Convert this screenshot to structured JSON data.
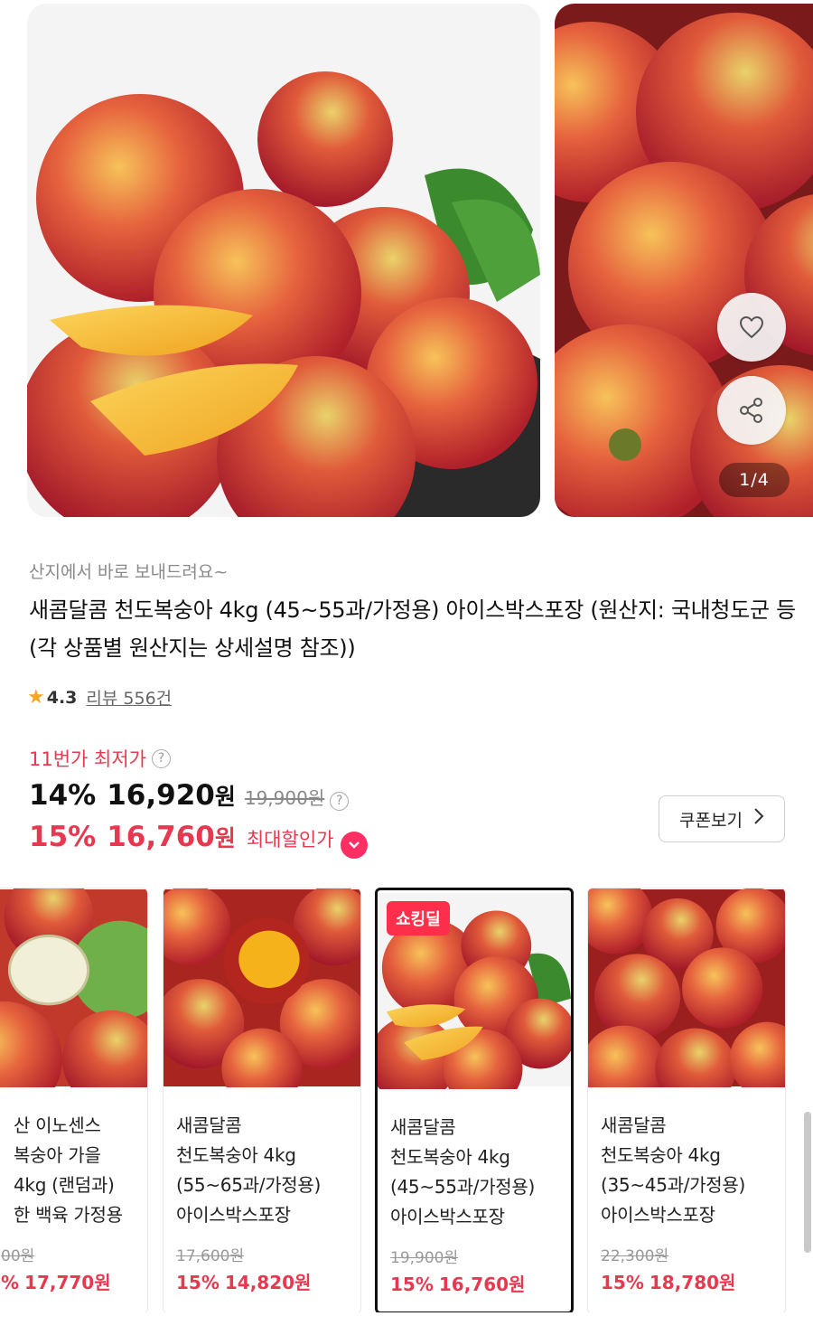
{
  "gallery": {
    "counter": "1/4",
    "like_icon": "heart-outline-icon",
    "share_icon": "share-icon"
  },
  "product": {
    "subtitle": "산지에서 바로 보내드려요~",
    "title": "새콤달콤 천도복숭아 4kg (45~55과/가정용) 아이스박스포장 (원산지: 국내청도군 등 (각 상품별 원산지는 상세설명 참조))",
    "rating": "4.3",
    "review_link": "리뷰 556건"
  },
  "pricing": {
    "lowest_label": "11번가 최저가",
    "row1": {
      "rate": "14%",
      "price": "16,920",
      "unit": "원",
      "original": "19,900원"
    },
    "row2": {
      "rate": "15%",
      "price": "16,760",
      "unit": "원",
      "label": "최대할인가"
    },
    "coupon_button": "쿠폰보기"
  },
  "options": [
    {
      "name": "산 이노센스\n복숭아 가을\n4kg (랜덤과)\n한 백육 가정용",
      "original": "00원",
      "rate": "%",
      "price": "17,770원",
      "badge": ""
    },
    {
      "name": "새콤달콤\n천도복숭아 4kg\n(55~65과/가정용)\n아이스박스포장",
      "original": "17,600원",
      "rate": "15%",
      "price": "14,820원",
      "badge": ""
    },
    {
      "name": "새콤달콤\n천도복숭아 4kg\n(45~55과/가정용)\n아이스박스포장",
      "original": "19,900원",
      "rate": "15%",
      "price": "16,760원",
      "badge": "쇼킹딜"
    },
    {
      "name": "새콤달콤\n천도복숭아 4kg\n(35~45과/가정용)\n아이스박스포장",
      "original": "22,300원",
      "rate": "15%",
      "price": "18,780원",
      "badge": ""
    }
  ],
  "colors": {
    "accent": "#e8384f",
    "badge": "#ff2e4a",
    "star": "#f5a623"
  }
}
